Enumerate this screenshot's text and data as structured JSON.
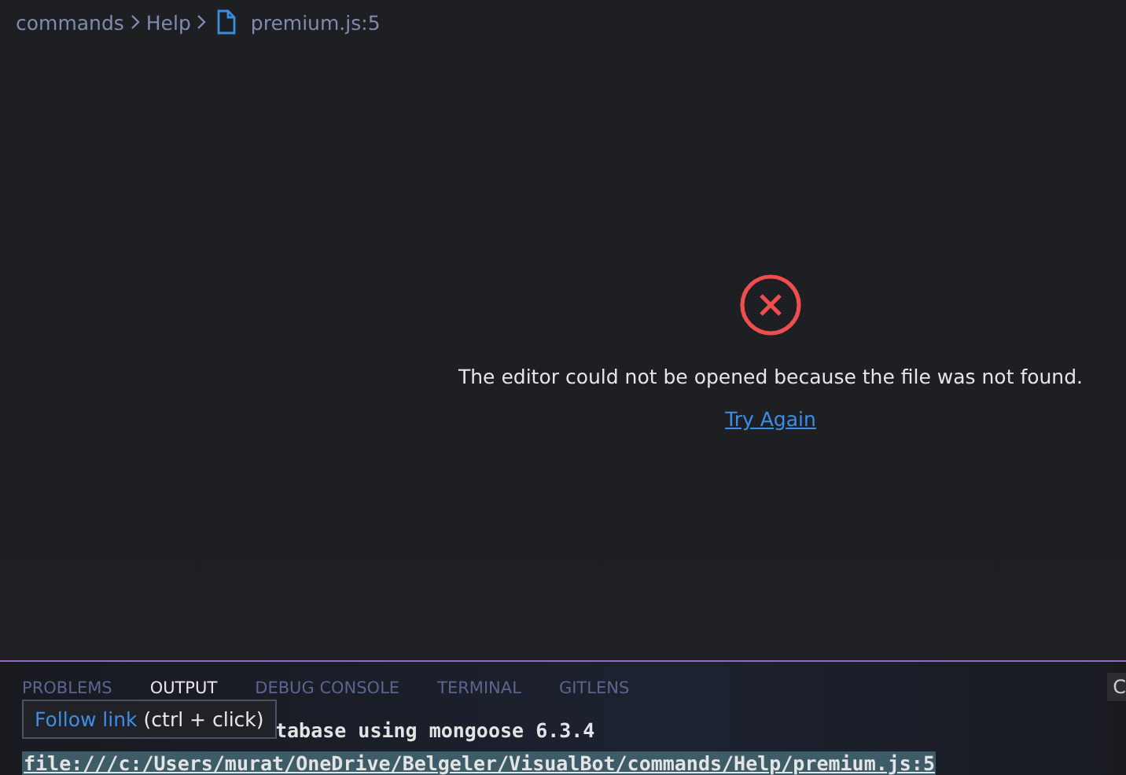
{
  "breadcrumbs": [
    {
      "label": "commands",
      "kind": "folder"
    },
    {
      "label": "Help",
      "kind": "folder"
    },
    {
      "label": "premium.js:5",
      "kind": "file"
    }
  ],
  "editor": {
    "message": "The editor could not be opened because the file was not found.",
    "action": "Try Again"
  },
  "panel": {
    "tabs": [
      {
        "label": "PROBLEMS",
        "selected": false
      },
      {
        "label": "OUTPUT",
        "selected": true
      },
      {
        "label": "DEBUG CONSOLE",
        "selected": false
      },
      {
        "label": "TERMINAL",
        "selected": false
      },
      {
        "label": "GITLENS",
        "selected": false
      }
    ],
    "corner_button": "C",
    "output_lines": [
      {
        "text": "tabase using mongoose 6.3.4",
        "selected": false
      },
      {
        "text": "file:///c:/Users/murat/OneDrive/Belgeler/VisualBot/commands/Help/premium.js:5",
        "selected": true
      }
    ],
    "tooltip": {
      "link": "Follow link",
      "hint": "(ctrl + click)"
    }
  }
}
